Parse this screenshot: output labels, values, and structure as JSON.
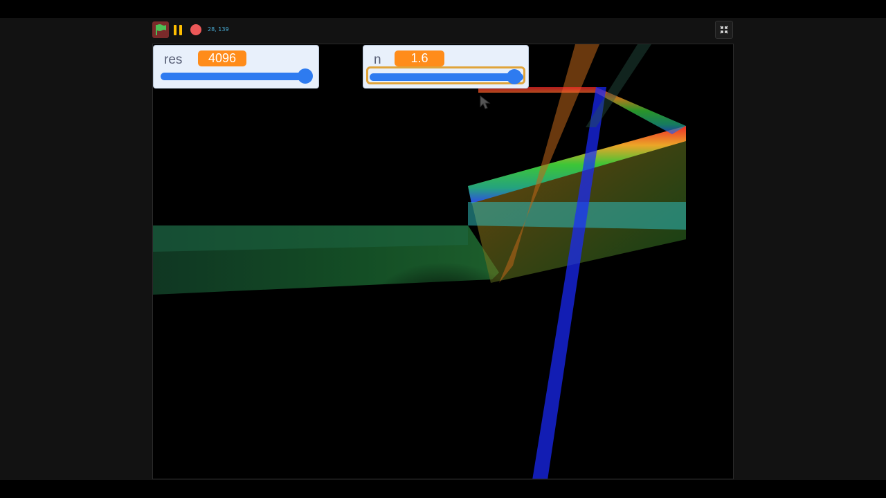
{
  "controls": {
    "mouse_readout": "28, 139"
  },
  "monitors": {
    "res": {
      "label": "res",
      "value": "4096",
      "slider_level": 1.0
    },
    "n": {
      "label": "n",
      "value": "1.6",
      "slider_level": 1.0
    }
  },
  "colors": {
    "accent": "#ff8c1a",
    "slider": "#2e7bf0",
    "flag": "#4cbf56",
    "pause": "#ffbf00",
    "stop": "#ec5959"
  }
}
